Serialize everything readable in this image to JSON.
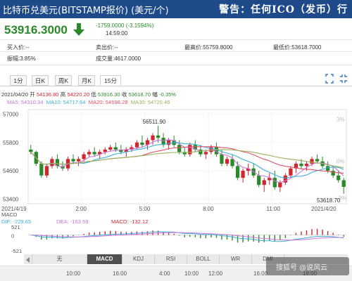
{
  "header": {
    "title": "比特币兑美元(BITSTAMP报价) (美元/个)",
    "warning": "警告：任何ICO（发币）行"
  },
  "quote": {
    "price": "53916.3000",
    "change": "-1759.0000 (-3.1594%)",
    "time": "14:59:00",
    "trend": "down"
  },
  "stats": {
    "buy_label": "买入价:--",
    "sell_label": "卖出价:--",
    "high_label": "最高价:55759.8000",
    "low_label": "最低价:53618.7000",
    "amplitude_label": "振幅:3.85%",
    "prev_close_label": "成交量:4617.0000"
  },
  "tabs": [
    {
      "label": "1分"
    },
    {
      "label": "日K"
    },
    {
      "label": "周K"
    },
    {
      "label": "月K"
    },
    {
      "label": "15分"
    }
  ],
  "active_tab": "15分",
  "ohlc": {
    "date": "2021/04/20",
    "open_label": "开",
    "open": "54136.80",
    "high_label": "高",
    "high": "54220.20",
    "low_label": "低",
    "low": "53916.30",
    "close_label": "收",
    "close": "53618.70",
    "pct_label": "幅",
    "pct": "-0.35%"
  },
  "ma": [
    {
      "label": "MA5: 54310.34",
      "color": "#c875d9"
    },
    {
      "label": "MA10: 54717.64",
      "color": "#3bb0d8"
    },
    {
      "label": "MA20: 54598.28",
      "color": "#e0506a"
    },
    {
      "label": "MA30: 54720.46",
      "color": "#9ab060"
    }
  ],
  "macd": {
    "name": "MACD",
    "dif": "DIF: -229.65",
    "dea": "DEA: -163.59",
    "macd": "MACD: -132.12",
    "y_ticks": [
      "521",
      "0",
      "-521"
    ]
  },
  "bottom_tabs": [
    {
      "label": "无"
    },
    {
      "label": "MACD"
    },
    {
      "label": "KDJ"
    },
    {
      "label": "RSI"
    },
    {
      "label": "BOLL"
    },
    {
      "label": "WR"
    },
    {
      "label": "DMI"
    }
  ],
  "active_bottom_tab": "MACD",
  "bottom_times": [
    "10:00",
    "16:00",
    "4:00",
    "10:00",
    "12:00",
    "16:00",
    "18:00"
  ],
  "watermark": "搜狐号 @说风云",
  "colors": {
    "up": "#d0262d",
    "down": "#2a8a2a",
    "header_bg": "#1e4a8a"
  },
  "chart_data": {
    "type": "candlestick",
    "y_ticks": [
      57000,
      55800,
      54600,
      53400
    ],
    "right_pct_ticks": [
      "3%",
      "0%",
      "-3%"
    ],
    "x_labels": [
      "2021/4/19",
      "2:00",
      "5:00",
      "8:00",
      "11:00",
      "2021/4/20"
    ],
    "annotations": [
      "56511.90",
      "53618.70"
    ],
    "candles": [
      [
        55500,
        55700,
        55300,
        55400
      ],
      [
        55400,
        55450,
        54800,
        54900
      ],
      [
        54900,
        55000,
        54300,
        54400
      ],
      [
        54400,
        54900,
        54300,
        54800
      ],
      [
        54800,
        55200,
        54700,
        55100
      ],
      [
        55100,
        55300,
        54700,
        54800
      ],
      [
        54800,
        55000,
        54600,
        54700
      ],
      [
        54700,
        55200,
        54600,
        55100
      ],
      [
        55100,
        55300,
        54900,
        55000
      ],
      [
        55000,
        55200,
        54800,
        55100
      ],
      [
        55100,
        55400,
        55000,
        55300
      ],
      [
        55300,
        55500,
        55200,
        55400
      ],
      [
        55400,
        55600,
        55200,
        55300
      ],
      [
        55300,
        55500,
        55100,
        55400
      ],
      [
        55400,
        55600,
        55300,
        55500
      ],
      [
        55500,
        55700,
        55400,
        55600
      ],
      [
        55600,
        55800,
        55400,
        55500
      ],
      [
        55500,
        55700,
        55300,
        55400
      ],
      [
        55400,
        55600,
        55200,
        55500
      ],
      [
        55500,
        55700,
        55400,
        55600
      ],
      [
        55600,
        55900,
        55500,
        55800
      ],
      [
        55800,
        56100,
        55600,
        55700
      ],
      [
        55700,
        56000,
        55500,
        55900
      ],
      [
        55900,
        56200,
        55700,
        56100
      ],
      [
        56100,
        56511.9,
        55800,
        56000
      ],
      [
        56000,
        56200,
        55600,
        55700
      ],
      [
        55700,
        56000,
        55500,
        55900
      ],
      [
        55900,
        56100,
        55600,
        55700
      ],
      [
        55700,
        55900,
        55300,
        55400
      ],
      [
        55400,
        55600,
        55200,
        55300
      ],
      [
        55300,
        55800,
        55200,
        55700
      ],
      [
        55700,
        55900,
        55400,
        55500
      ],
      [
        55500,
        55700,
        55200,
        55300
      ],
      [
        55300,
        55500,
        55100,
        55400
      ],
      [
        55400,
        55700,
        55300,
        55600
      ],
      [
        55600,
        55800,
        55200,
        55300
      ],
      [
        55300,
        55500,
        54800,
        54900
      ],
      [
        54900,
        55200,
        54800,
        55100
      ],
      [
        55100,
        55300,
        54700,
        54800
      ],
      [
        54800,
        55000,
        54200,
        54300
      ],
      [
        54300,
        54700,
        54100,
        54600
      ],
      [
        54600,
        54900,
        54400,
        54700
      ],
      [
        54700,
        54900,
        54300,
        54400
      ],
      [
        54400,
        54600,
        53900,
        54000
      ],
      [
        54000,
        54300,
        53700,
        54200
      ],
      [
        54200,
        54500,
        54000,
        54300
      ],
      [
        54300,
        54600,
        53800,
        53900
      ],
      [
        53900,
        54200,
        53700,
        54100
      ],
      [
        54100,
        54500,
        54000,
        54400
      ],
      [
        54400,
        54800,
        54300,
        54700
      ],
      [
        54700,
        55000,
        54500,
        54900
      ],
      [
        54900,
        55100,
        54700,
        54800
      ],
      [
        54800,
        55000,
        54600,
        54900
      ],
      [
        54900,
        55200,
        54800,
        55100
      ],
      [
        55100,
        55300,
        54900,
        55000
      ],
      [
        55000,
        55200,
        54700,
        54800
      ],
      [
        54800,
        55000,
        54500,
        54600
      ],
      [
        54600,
        54800,
        54300,
        54400
      ],
      [
        54400,
        54600,
        54100,
        54200
      ],
      [
        54200,
        54300,
        53618.7,
        53916.3
      ]
    ]
  }
}
